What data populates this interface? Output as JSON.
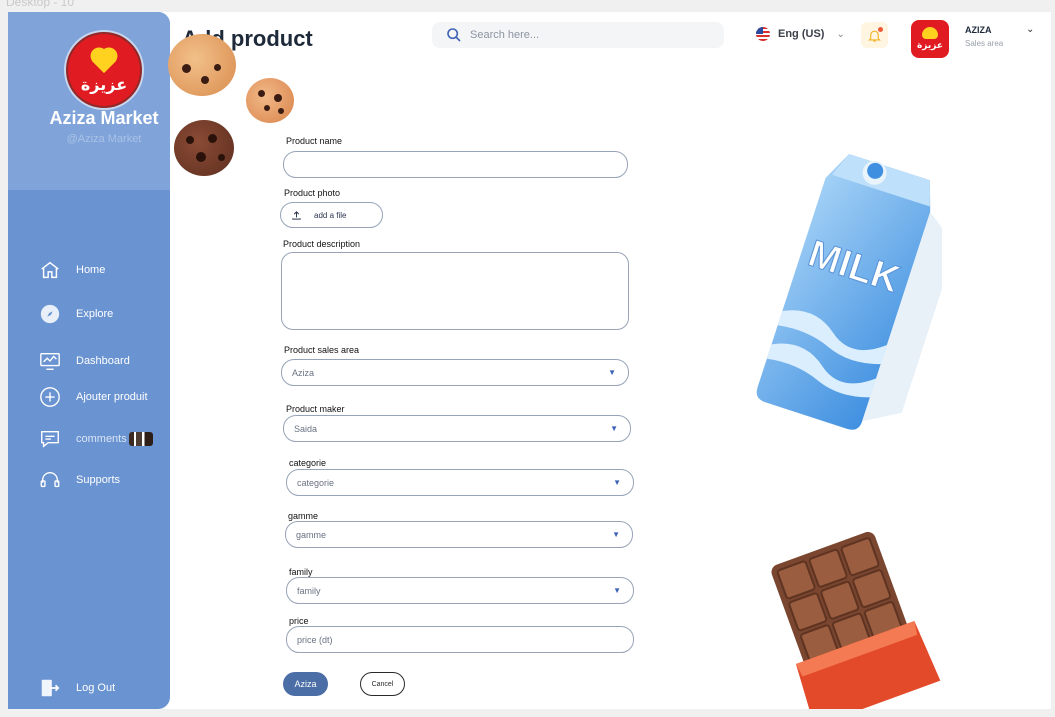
{
  "frame_label": "Desktop - 10",
  "brand": {
    "logo_text": "عزيزة",
    "name": "Aziza Market",
    "handle": "@Aziza Market"
  },
  "nav": {
    "home": "Home",
    "explore": "Explore",
    "dashboard": "Dashboard",
    "add_product": "Ajouter  produit",
    "comments": "comments",
    "supports": "Supports",
    "logout": "Log Out"
  },
  "header": {
    "title": "Add product",
    "search_placeholder": "Search here...",
    "language": "Eng (US)",
    "user_name": "AZIZA",
    "user_role": "Sales area"
  },
  "form": {
    "product_name_label": "Product name",
    "product_name_value": "",
    "product_photo_label": "Product photo",
    "upload_label": "add a file",
    "description_label": "Product description",
    "sales_area_label": "Product sales area",
    "sales_area_value": "Aziza",
    "maker_label": "Product maker",
    "maker_value": "Saida",
    "category_label": "categorie",
    "category_value": "categorie",
    "gamme_label": "gamme",
    "gamme_value": "gamme",
    "family_label": "family",
    "family_value": "family",
    "price_label": "price",
    "price_placeholder": "price (dt)",
    "submit_label": "Aziza",
    "cancel_label": "Cancel"
  },
  "illustrations": {
    "milk_text": "MILK"
  },
  "colors": {
    "sidebar": "#6a93d1",
    "sidebar_top": "#80a4da",
    "brand_red": "#e11b22",
    "submit": "#4a6ea5"
  }
}
